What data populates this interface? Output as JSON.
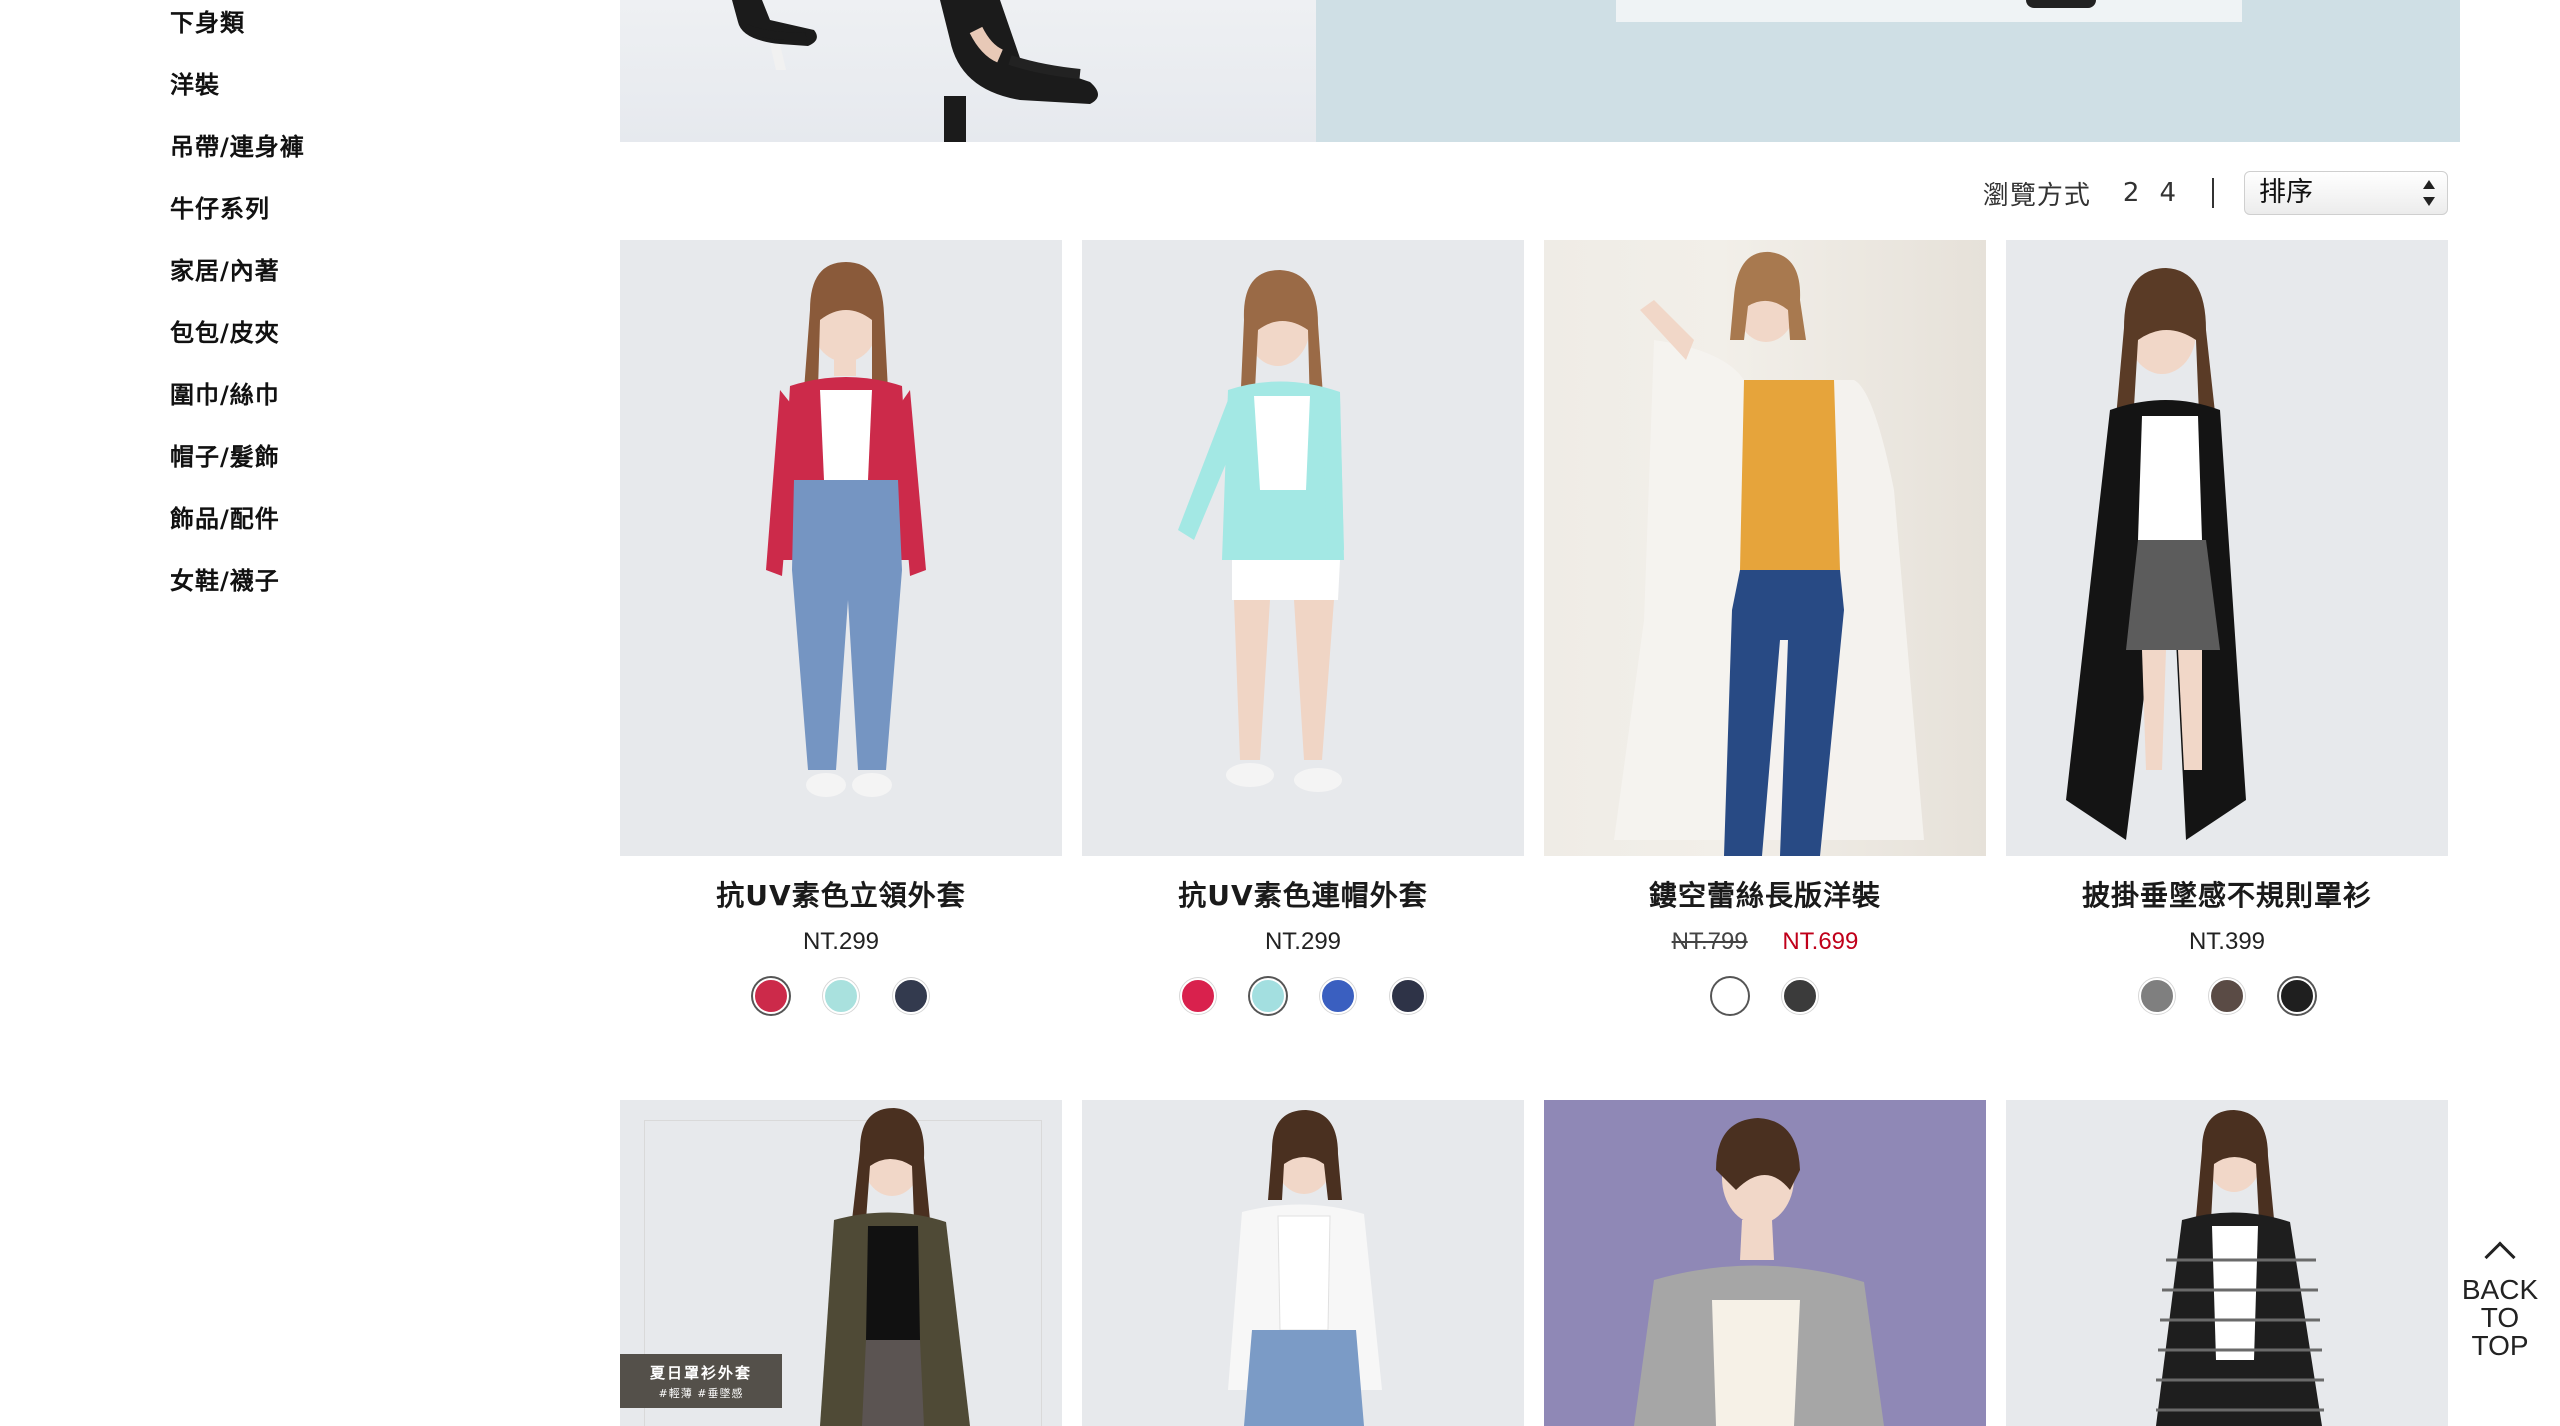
{
  "sidebar": {
    "items": [
      {
        "label": "下身類"
      },
      {
        "label": "洋裝"
      },
      {
        "label": "吊帶/連身褲"
      },
      {
        "label": "牛仔系列"
      },
      {
        "label": "家居/內著"
      },
      {
        "label": "包包/皮夾"
      },
      {
        "label": "圍巾/絲巾"
      },
      {
        "label": "帽子/髮飾"
      },
      {
        "label": "飾品/配件"
      },
      {
        "label": "女鞋/襪子"
      }
    ]
  },
  "toolbar": {
    "view_label": "瀏覽方式",
    "view_options": [
      "2",
      "4"
    ],
    "sort_label": "排序"
  },
  "products": [
    {
      "name": "抗UV素色立領外套",
      "price": "NT.299",
      "colors": [
        "#cc2a4a",
        "#a9e1de",
        "#333a4e"
      ],
      "selected_color": 0
    },
    {
      "name": "抗UV素色連帽外套",
      "price": "NT.299",
      "colors": [
        "#d9214d",
        "#a3dfe0",
        "#3a5fc0",
        "#2e3347"
      ],
      "selected_color": 1
    },
    {
      "name": "鏤空蕾絲長版洋裝",
      "old_price": "NT.799",
      "sale_price": "NT.699",
      "colors": [
        "#ffffff",
        "#3b3b3b"
      ],
      "selected_color": 0
    },
    {
      "name": "披掛垂墜感不規則罩衫",
      "price": "NT.399",
      "colors": [
        "#7f7f7f",
        "#5a4b45",
        "#1f1f1f"
      ],
      "selected_color": 2
    }
  ],
  "second_row": {
    "promo_tag": {
      "line1": "夏日罩衫外套",
      "line2": "#輕薄 #垂墜感"
    }
  },
  "back_to_top": {
    "line1": "BACK",
    "line2": "TO",
    "line3": "TOP"
  }
}
